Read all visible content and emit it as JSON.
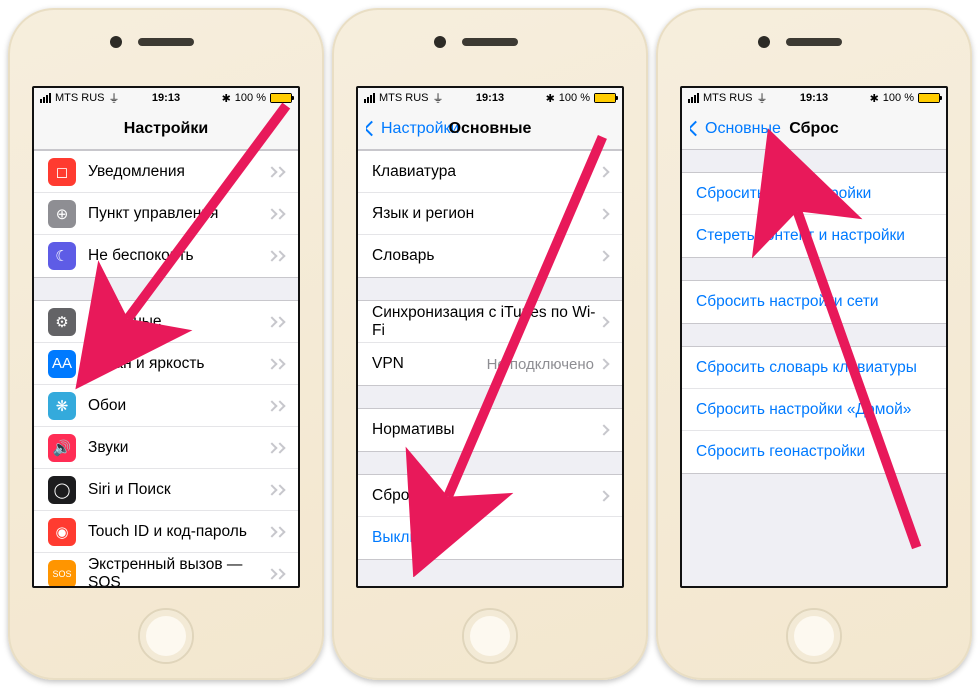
{
  "status": {
    "carrier": "MTS RUS",
    "time": "19:13",
    "bluetooth": "✳︎",
    "battery_pct": "100 %"
  },
  "phone1": {
    "title": "Настройки",
    "rows_g1": [
      {
        "label": "Уведомления",
        "icon": "notifications-icon",
        "bg": "bg-red",
        "glyph": "◻︎"
      },
      {
        "label": "Пункт управления",
        "icon": "control-center-icon",
        "bg": "bg-gray",
        "glyph": "⊕"
      },
      {
        "label": "Не беспокоить",
        "icon": "do-not-disturb-icon",
        "bg": "bg-moon",
        "glyph": "☾"
      }
    ],
    "rows_g2": [
      {
        "label": "Основные",
        "icon": "general-icon",
        "bg": "bg-dark",
        "glyph": "⚙︎"
      },
      {
        "label": "Экран и яркость",
        "icon": "display-icon",
        "bg": "bg-blue",
        "glyph": "AA"
      },
      {
        "label": "Обои",
        "icon": "wallpaper-icon",
        "bg": "bg-teal",
        "glyph": "❋"
      },
      {
        "label": "Звуки",
        "icon": "sounds-icon",
        "bg": "bg-pink",
        "glyph": "🔊"
      },
      {
        "label": "Siri и Поиск",
        "icon": "siri-icon",
        "bg": "bg-black",
        "glyph": "◯"
      },
      {
        "label": "Touch ID и код-пароль",
        "icon": "touchid-icon",
        "bg": "bg-red",
        "glyph": "◉"
      },
      {
        "label": "Экстренный вызов — SOS",
        "icon": "sos-icon",
        "bg": "bg-orange",
        "glyph": "SOS"
      }
    ]
  },
  "phone2": {
    "back": "Настройки",
    "title": "Основные",
    "rows_g1": [
      {
        "label": "Клавиатура"
      },
      {
        "label": "Язык и регион"
      },
      {
        "label": "Словарь"
      }
    ],
    "rows_g2": [
      {
        "label": "Синхронизация с iTunes по Wi-Fi"
      },
      {
        "label": "VPN",
        "value": "Не подключено"
      }
    ],
    "rows_g3": [
      {
        "label": "Нормативы"
      }
    ],
    "rows_g4": [
      {
        "label": "Сброс"
      },
      {
        "label": "Выключить",
        "link": true,
        "nochev": true
      }
    ]
  },
  "phone3": {
    "back": "Основные",
    "title": "Сброс",
    "rows_g1": [
      {
        "label": "Сбросить все настройки",
        "link": true
      },
      {
        "label": "Стереть контент и настройки",
        "link": true
      }
    ],
    "rows_g2": [
      {
        "label": "Сбросить настройки сети",
        "link": true
      }
    ],
    "rows_g3": [
      {
        "label": "Сбросить словарь клавиатуры",
        "link": true
      },
      {
        "label": "Сбросить настройки «Домой»",
        "link": true
      },
      {
        "label": "Сбросить геонастройки",
        "link": true
      }
    ]
  },
  "annotation_arrow_color": "#e8195a"
}
